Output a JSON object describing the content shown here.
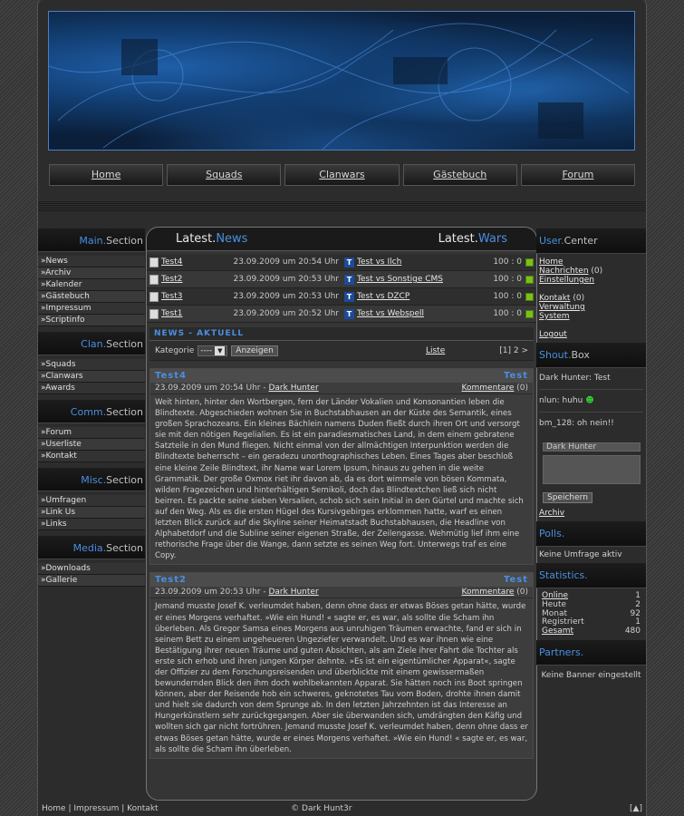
{
  "nav": [
    "Home",
    "Squads",
    "Clanwars",
    "Gästebuch",
    "Forum"
  ],
  "left": [
    {
      "a": "Main.",
      "b": "Section",
      "items": [
        "»News",
        "»Archiv",
        "»Kalender",
        "»Gästebuch",
        "»Impressum",
        "»Scriptinfo"
      ]
    },
    {
      "a": "Clan.",
      "b": "Section",
      "items": [
        "»Squads",
        "»Clanwars",
        "»Awards"
      ]
    },
    {
      "a": "Comm.",
      "b": "Section",
      "items": [
        "»Forum",
        "»Userliste",
        "»Kontakt"
      ]
    },
    {
      "a": "Misc.",
      "b": "Section",
      "items": [
        "»Umfragen",
        "»Link Us",
        "»Links"
      ]
    },
    {
      "a": "Media.",
      "b": "Section",
      "items": [
        "»Downloads",
        "»Gallerie"
      ]
    }
  ],
  "center": {
    "latest_news_a": "Latest.",
    "latest_news_b": "News",
    "latest_wars_a": "Latest.",
    "latest_wars_b": "Wars",
    "news_rows": [
      {
        "t": "Test4",
        "d": "23.09.2009 um 20:54 Uhr"
      },
      {
        "t": "Test2",
        "d": "23.09.2009 um 20:53 Uhr"
      },
      {
        "t": "Test3",
        "d": "23.09.2009 um 20:53 Uhr"
      },
      {
        "t": "Test1",
        "d": "23.09.2009 um 20:52 Uhr"
      }
    ],
    "war_rows": [
      {
        "t": "Test vs Ilch",
        "s": "100 : 0"
      },
      {
        "t": "Test vs Sonstige CMS",
        "s": "100 : 0"
      },
      {
        "t": "Test vs DZCP",
        "s": "100 : 0"
      },
      {
        "t": "Test vs Webspell",
        "s": "100 : 0"
      }
    ],
    "section_title": "NEWS - AKTUELL",
    "filter_label": "Kategorie",
    "select_value": "----",
    "btn": "Anzeigen",
    "liste": "Liste",
    "pager": "[1] 2 >",
    "articles": [
      {
        "title": "Test4",
        "cat": "Test",
        "date": "23.09.2009 um 20:54 Uhr - ",
        "author": "Dark Hunter",
        "comments": "Kommentare",
        "count": "(0)",
        "body": "Weit hinten, hinter den Wortbergen, fern der Länder Vokalien und Konsonantien leben die Blindtexte. Abgeschieden wohnen Sie in Buchstabhausen an der Küste des Semantik, eines großen Sprachozeans. Ein kleines Bächlein namens Duden fließt durch ihren Ort und versorgt sie mit den nötigen Regelialien. Es ist ein paradiesmatisches Land, in dem einem gebratene Satzteile in den Mund fliegen. Nicht einmal von der allmächtigen Interpunktion werden die Blindtexte beherrscht – ein geradezu unorthographisches Leben. Eines Tages aber beschloß eine kleine Zeile Blindtext, ihr Name war Lorem Ipsum, hinaus zu gehen in die weite Grammatik. Der große Oxmox riet ihr davon ab, da es dort wimmele von bösen Kommata, wilden Fragezeichen und hinterhältigen Semikoli, doch das Blindtextchen ließ sich nicht beirren. Es packte seine sieben Versalien, schob sich sein Initial in den Gürtel und machte sich auf den Weg. Als es die ersten Hügel des Kursivgebirges erklommen hatte, warf es einen letzten Blick zurück auf die Skyline seiner Heimatstadt Buchstabhausen, die Headline von Alphabetdorf und die Subline seiner eigenen Straße, der Zeilengasse. Wehmütig lief ihm eine rethorische Frage über die Wange, dann setzte es seinen Weg fort. Unterwegs traf es eine Copy."
      },
      {
        "title": "Test2",
        "cat": "Test",
        "date": "23.09.2009 um 20:53 Uhr - ",
        "author": "Dark Hunter",
        "comments": "Kommentare",
        "count": "(0)",
        "body": "Jemand musste Josef K. verleumdet haben, denn ohne dass er etwas Böses getan hätte, wurde er eines Morgens verhaftet. »Wie ein Hund! « sagte er, es war, als sollte die Scham ihn überleben. Als Gregor Samsa eines Morgens aus unruhigen Träumen erwachte, fand er sich in seinem Bett zu einem ungeheueren Ungeziefer verwandelt. Und es war ihnen wie eine Bestätigung ihrer neuen Träume und guten Absichten, als am Ziele ihrer Fahrt die Tochter als erste sich erhob und ihren jungen Körper dehnte. »Es ist ein eigentümlicher Apparat«, sagte der Offizier zu dem Forschungsreisenden und überblickte mit einem gewissermaßen bewundernden Blick den ihm doch wohlbekannten Apparat. Sie hätten noch ins Boot springen können, aber der Reisende hob ein schweres, geknotetes Tau vom Boden, drohte ihnen damit und hielt sie dadurch von dem Sprunge ab. In den letzten Jahrzehnten ist das Interesse an Hungerkünstlern sehr zurückgegangen. Aber sie überwanden sich, umdrängten den Käfig und wollten sich gar nicht fortrühren. Jemand musste Josef K. verleumdet haben, denn ohne dass er etwas Böses getan hätte, wurde er eines Morgens verhaftet. »Wie ein Hund! « sagte er, es war, als sollte die Scham ihn überleben."
      }
    ]
  },
  "right": {
    "user_a": "User.",
    "user_b": "Center",
    "user_links": [
      "Home",
      "Nachrichten",
      "(0)",
      "Einstellungen",
      "Kontakt",
      "(0)",
      "Verwaltung",
      "System",
      "Logout"
    ],
    "shout_a": "Shout.",
    "shout_b": "Box",
    "shouts": [
      "Dark Hunter: Test",
      "nlun: huhu",
      "bm_128: oh nein!!"
    ],
    "shout_name": "Dark Hunter",
    "shout_btn": "Speichern",
    "shout_archiv": "Archiv",
    "polls_a": "Polls.",
    "polls_text": "Keine Umfrage aktiv",
    "stats_a": "Statistics.",
    "stats": [
      {
        "k": "Online",
        "v": "1"
      },
      {
        "k": "Heute",
        "v": "2"
      },
      {
        "k": "Monat",
        "v": "92"
      },
      {
        "k": "Registriert",
        "v": "1"
      },
      {
        "k": "Gesamt",
        "v": "480"
      }
    ],
    "partners_a": "Partners.",
    "partners_text": "Keine Banner eingestellt"
  },
  "footer": {
    "links": "Home | Impressum | Kontakt",
    "copy": "© Dark Hunt3r",
    "top": "[▲]"
  }
}
